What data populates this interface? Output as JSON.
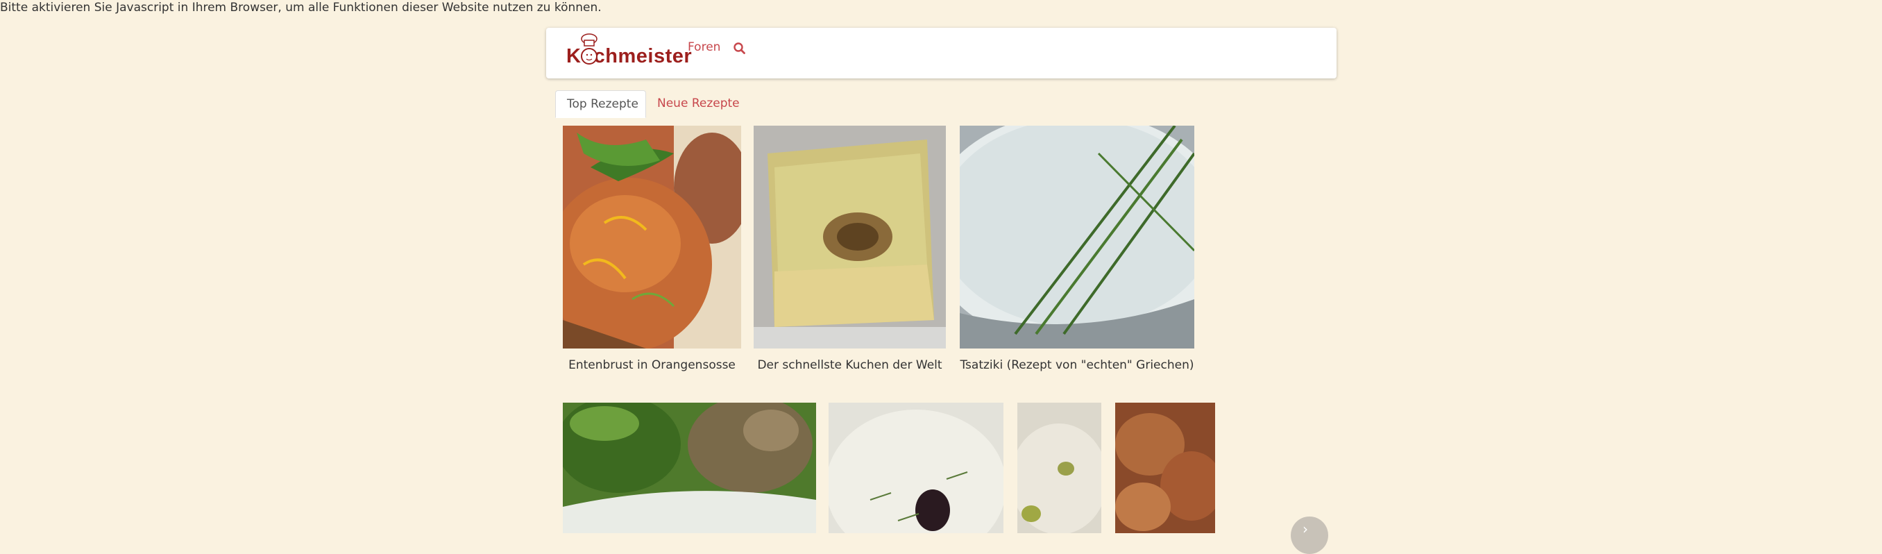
{
  "notice": "Bitte aktivieren Sie Javascript in Ihrem Browser, um alle Funktionen dieser Website nutzen zu können.",
  "header": {
    "logo_text": "Kochmeister",
    "nav_link": "Foren",
    "search_icon": "search-icon"
  },
  "tabs": [
    {
      "label": "Top Rezepte",
      "active": true
    },
    {
      "label": "Neue Rezepte",
      "active": false
    }
  ],
  "top_recipes": [
    {
      "title": "Entenbrust in Orangensosse"
    },
    {
      "title": "Der schnellste Kuchen der Welt"
    },
    {
      "title": "Tsatziki (Rezept von \"echten\" Griechen)"
    }
  ],
  "colors": {
    "background": "#faf2e0",
    "brand": "#9c1f1d",
    "link": "#c7474c"
  },
  "carousel_next_icon": "chevron-right-icon"
}
